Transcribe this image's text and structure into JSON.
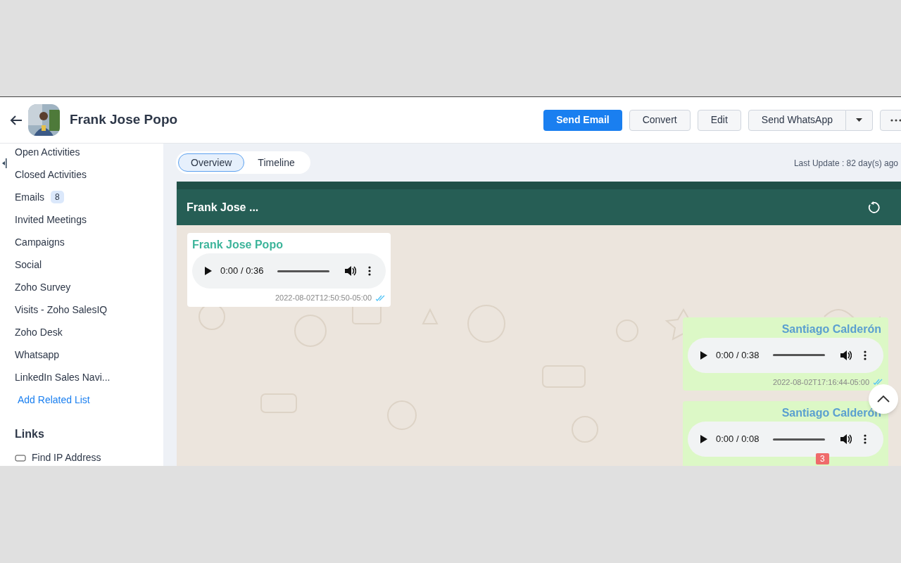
{
  "header": {
    "name": "Frank Jose Popo",
    "buttons": [
      {
        "label": "Send Email",
        "kind": "primary"
      },
      {
        "label": "Convert",
        "kind": "default"
      },
      {
        "label": "Edit",
        "kind": "default"
      },
      {
        "label": "Send WhatsApp",
        "kind": "split"
      }
    ]
  },
  "sidebar": {
    "items": [
      {
        "label": "Open Activities"
      },
      {
        "label": "Closed Activities"
      },
      {
        "label": "Emails",
        "count": "8"
      },
      {
        "label": "Invited Meetings"
      },
      {
        "label": "Campaigns"
      },
      {
        "label": "Social"
      },
      {
        "label": "Zoho Survey"
      },
      {
        "label": "Visits - Zoho SalesIQ"
      },
      {
        "label": "Zoho Desk"
      },
      {
        "label": "Whatsapp"
      },
      {
        "label": "LinkedIn Sales Navi..."
      }
    ],
    "add_link": "Add Related List",
    "links_heading": "Links",
    "links": [
      {
        "label": "Find IP Address"
      }
    ]
  },
  "tabs": [
    {
      "label": "Overview",
      "selected": true
    },
    {
      "label": "Timeline",
      "selected": false
    }
  ],
  "last_update": "Last Update : 82 day(s) ago",
  "chat": {
    "title": "Frank Jose ...",
    "messages": [
      {
        "kind": "incoming",
        "sender": "Frank Jose Popo",
        "time": "0:00 / 0:36",
        "timestamp": "2022-08-02T12:50:50-05:00",
        "read": true
      },
      {
        "kind": "outgoing",
        "sender": "Santiago Calderón",
        "time": "0:00 / 0:38",
        "timestamp": "2022-08-02T17:16:44-05:00",
        "read": true
      },
      {
        "kind": "outgoing",
        "sender": "Santiago Calderón",
        "time": "0:00 / 0:08"
      }
    ],
    "unread_badge": "3"
  }
}
